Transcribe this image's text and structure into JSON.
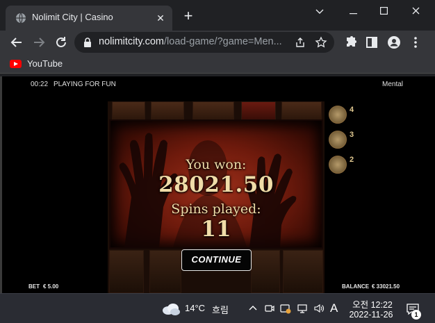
{
  "browser": {
    "tab_title": "Nolimit City | Casino",
    "url_host": "nolimitcity.com",
    "url_path": "/load-game/?game=Men...",
    "bookmark_label": "YouTube"
  },
  "game": {
    "timer": "00:22",
    "mode": "PLAYING FOR FUN",
    "game_name": "Mental",
    "win_label": "You won:",
    "win_amount": "28021.50",
    "spins_label": "Spins played:",
    "spins_count": "11",
    "continue_label": "CONTINUE",
    "bet_label": "BET",
    "bet_value": "€ 5.00",
    "balance_label": "BALANCE",
    "balance_value": "€ 33021.50",
    "side_numbers": [
      "4",
      "3",
      "2"
    ]
  },
  "taskbar": {
    "temperature": "14°C",
    "condition": "흐림",
    "ime_label": "A",
    "time": "오전 12:22",
    "date": "2022-11-26",
    "notification_count": "1"
  },
  "colors": {
    "chrome_dark": "#202124",
    "chrome_toolbar": "#35363a",
    "panel_red": "#9c2f1a",
    "win_text": "#f0dca8",
    "taskbar": "#2a2c33"
  }
}
